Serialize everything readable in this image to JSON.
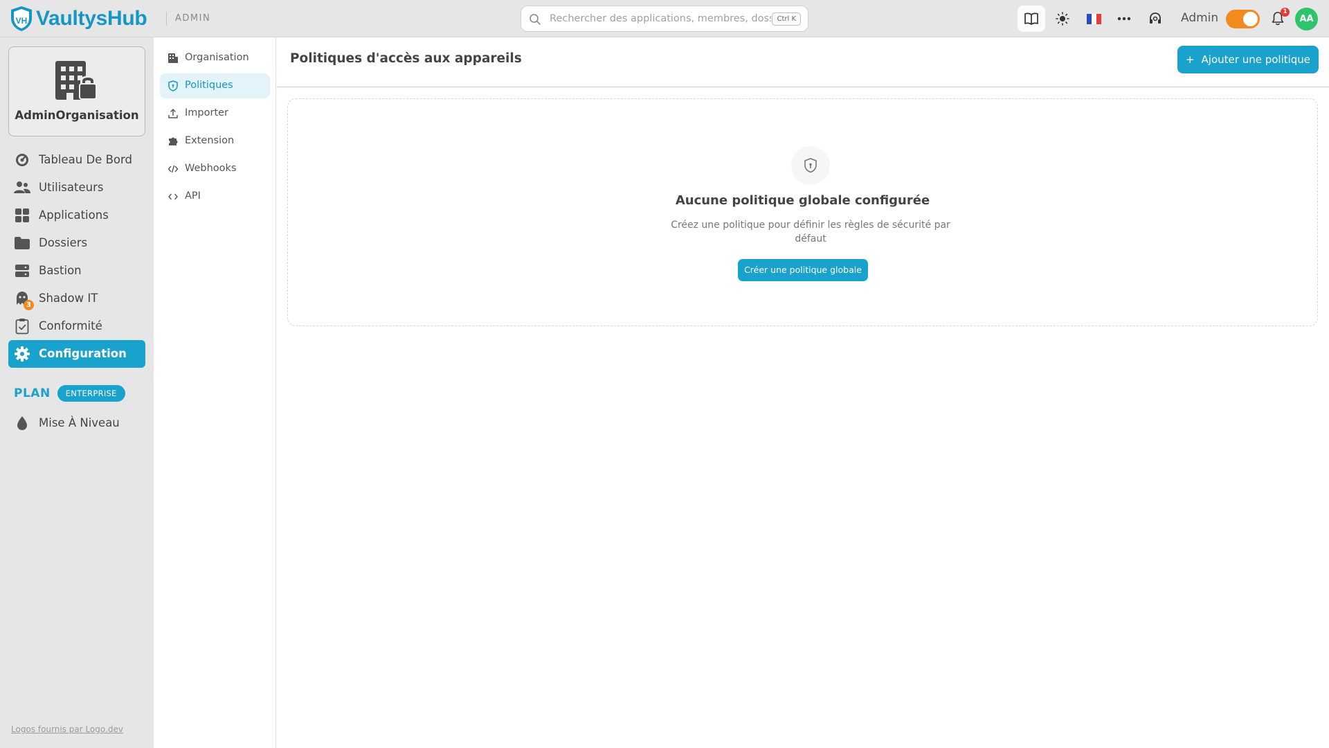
{
  "app": {
    "logo_text": "VaultysHub",
    "section_tag": "ADMIN"
  },
  "topbar": {
    "search_placeholder": "Rechercher des applications, membres, dossiers...",
    "search_shortcut": "Ctrl K",
    "icons": [
      "book-icon",
      "sun-icon",
      "france-flag-icon",
      "more-dots-icon",
      "support-headset-icon",
      "bell-icon"
    ],
    "role_label": "Admin",
    "notification_count": "1",
    "avatar_initials": "AA",
    "toggle_on": true
  },
  "sidebar": {
    "org_name": "AdminOrganisation",
    "items": [
      {
        "label": "Tableau De Bord",
        "icon": "dashboard-gauge-icon"
      },
      {
        "label": "Utilisateurs",
        "icon": "users-icon"
      },
      {
        "label": "Applications",
        "icon": "apps-grid-icon"
      },
      {
        "label": "Dossiers",
        "icon": "folder-icon"
      },
      {
        "label": "Bastion",
        "icon": "server-icon"
      },
      {
        "label": "Shadow IT",
        "icon": "ghost-icon",
        "badge": "3"
      },
      {
        "label": "Conformité",
        "icon": "clipboard-check-icon"
      },
      {
        "label": "Configuration",
        "icon": "gear-icon",
        "active": true
      }
    ],
    "plan_label": "PLAN",
    "plan_name": "ENTERPRISE",
    "upgrade_label": "Mise À Niveau",
    "footer_link": "Logos fournis par Logo.dev"
  },
  "subnav": {
    "items": [
      {
        "label": "Organisation",
        "icon": "building-icon"
      },
      {
        "label": "Politiques",
        "icon": "shield-icon",
        "active": true
      },
      {
        "label": "Importer",
        "icon": "upload-icon"
      },
      {
        "label": "Extension",
        "icon": "puzzle-icon"
      },
      {
        "label": "Webhooks",
        "icon": "code-slash-icon"
      },
      {
        "label": "API",
        "icon": "code-brackets-icon"
      }
    ]
  },
  "main": {
    "title": "Politiques d'accès aux appareils",
    "add_button": "Ajouter une politique",
    "empty": {
      "title": "Aucune politique globale configurée",
      "description": "Créez une politique pour définir les règles de sécurité par défaut",
      "button": "Créer une politique globale"
    }
  },
  "colors": {
    "accent": "#18a2cc",
    "orange": "#f28a1e",
    "sidebar_bg": "#e6e6e6",
    "avatar": "#2ec46b"
  }
}
